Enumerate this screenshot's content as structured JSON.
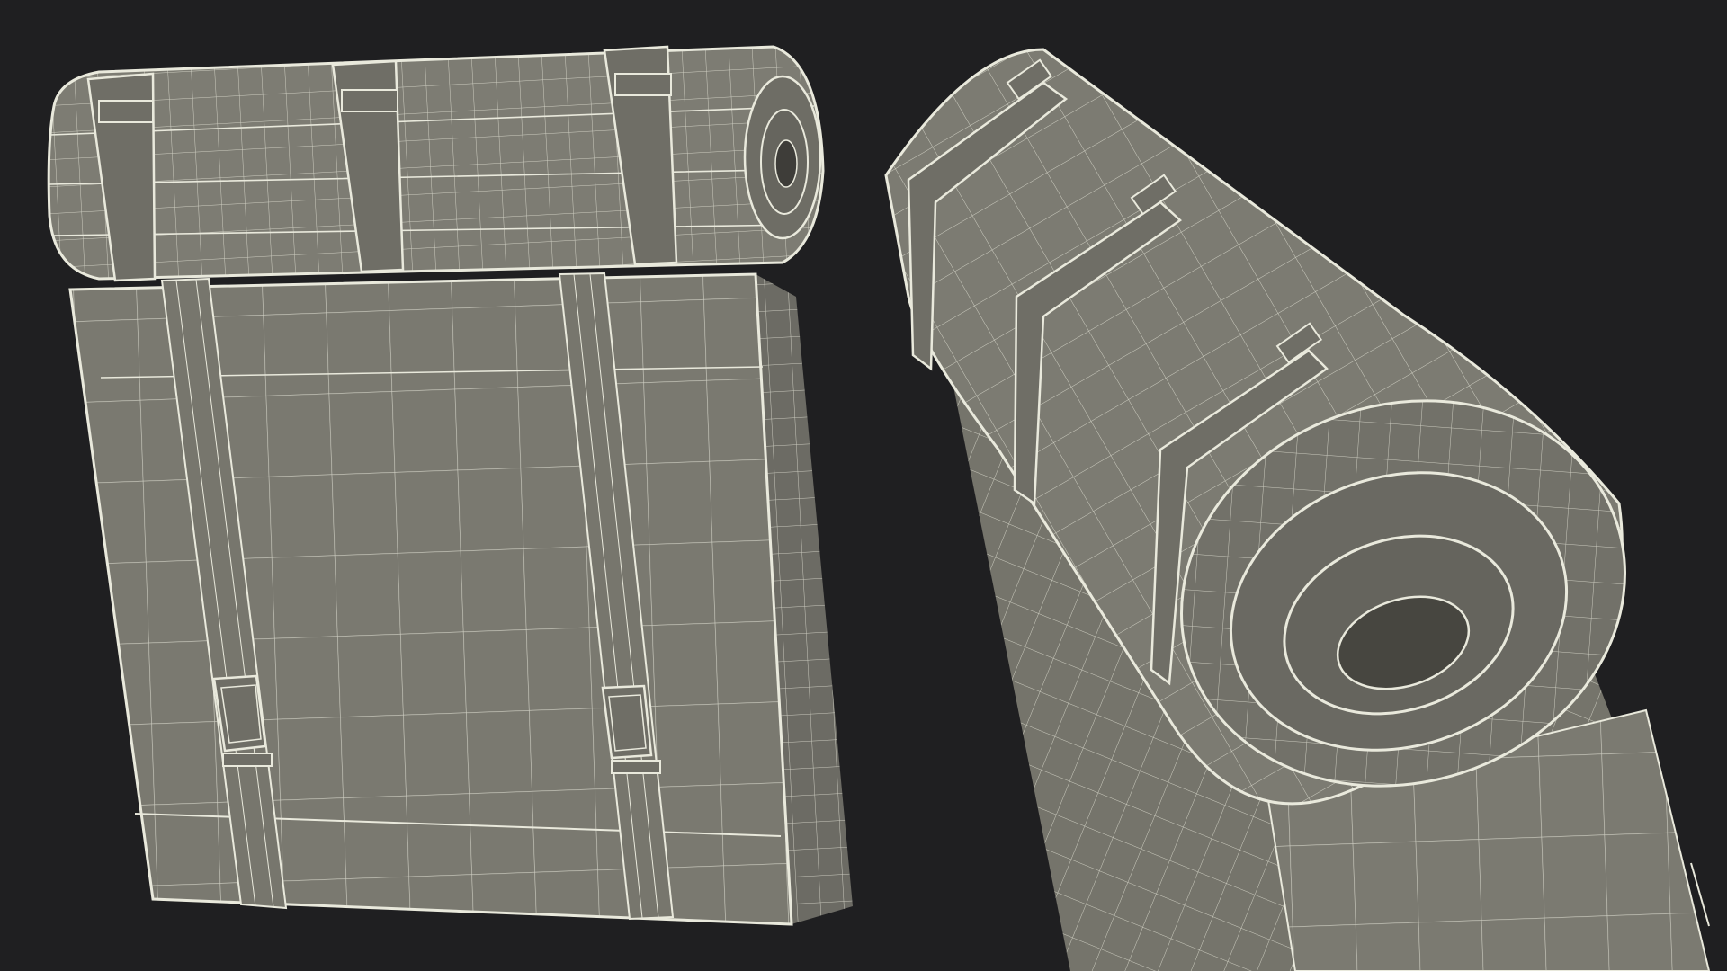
{
  "scene": {
    "background_color": "#1f1f21",
    "mesh_fill_color": "#7c7b72",
    "mesh_shadow_color": "#5e5d57",
    "wire_color": "#e9e9dc",
    "views": [
      {
        "id": "front",
        "subject": "backpack-with-bedroll"
      },
      {
        "id": "closeup",
        "subject": "bedroll-end"
      }
    ]
  }
}
